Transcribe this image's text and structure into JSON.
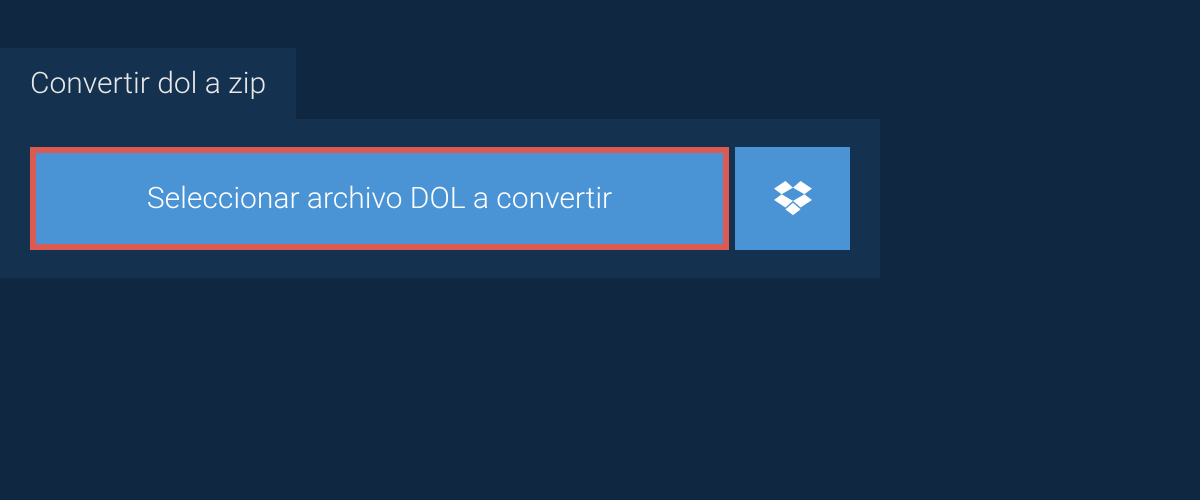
{
  "tab": {
    "label": "Convertir dol a zip"
  },
  "actions": {
    "select_file_label": "Seleccionar archivo DOL a convertir"
  }
}
